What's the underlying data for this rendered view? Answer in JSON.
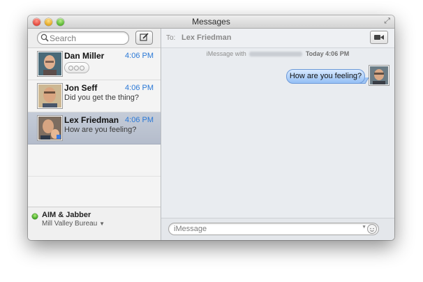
{
  "window": {
    "title": "Messages"
  },
  "sidebar": {
    "search_placeholder": "Search",
    "conversations": [
      {
        "name": "Dan Miller",
        "time": "4:06 PM",
        "snippet": "",
        "typing_indicator": true,
        "selected": false
      },
      {
        "name": "Jon Seff",
        "time": "4:06 PM",
        "snippet": "Did you get the thing?",
        "typing_indicator": false,
        "selected": false
      },
      {
        "name": "Lex Friedman",
        "time": "4:06 PM",
        "snippet": "How are you feeling?",
        "typing_indicator": false,
        "selected": true
      }
    ],
    "account": {
      "name": "AIM & Jabber",
      "status": "Mill Valley Bureau",
      "status_color": "#3a9e1e"
    }
  },
  "main": {
    "to_label": "To:",
    "recipient": "Lex Friedman",
    "meta_prefix": "iMessage with",
    "meta_time": "Today 4:06 PM",
    "messages": [
      {
        "text": "How are you feeling?",
        "from_me": true
      }
    ],
    "input_placeholder": "iMessage"
  },
  "colors": {
    "accent_time": "#2a78d6",
    "bubble": "#94bff5",
    "selection": "#b4bccb"
  }
}
